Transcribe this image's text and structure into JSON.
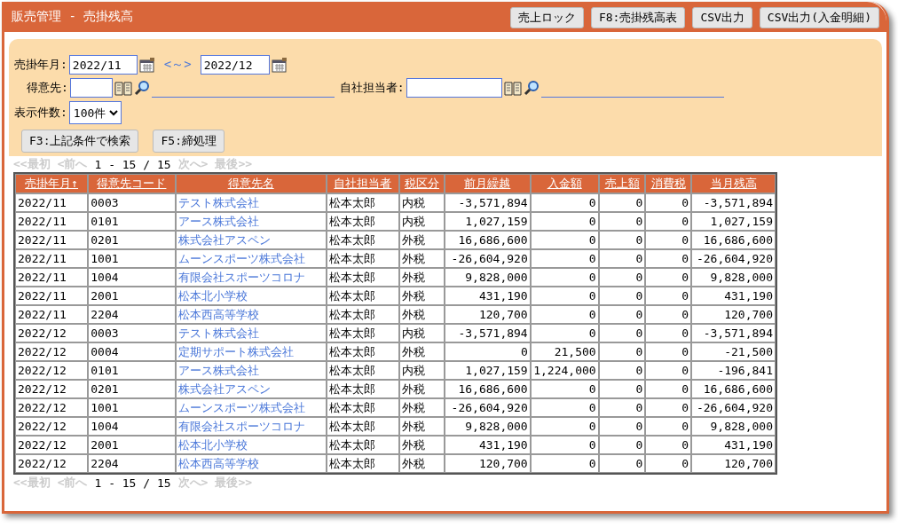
{
  "window": {
    "title": "販売管理 - 売掛残高"
  },
  "header_buttons": [
    "売上ロック",
    "F8:売掛残高表",
    "CSV出力",
    "CSV出力(入金明細)"
  ],
  "filters": {
    "period_label": "売掛年月:",
    "period_from": "2022/11",
    "range_separator": "<～>",
    "period_to": "2022/12",
    "customer_label": "得意先:",
    "staff_label": "自社担当者:",
    "count_label": "表示件数:",
    "count_value": "100件"
  },
  "action_buttons": [
    "F3:上記条件で検索",
    "F5:締処理"
  ],
  "pager_top": {
    "first": {
      "label": "<<最初",
      "disabled": true
    },
    "prev": {
      "label": "<前へ",
      "disabled": true
    },
    "range": "1 - 15 / 15",
    "next": {
      "label": "次へ>",
      "disabled": true
    },
    "last": {
      "label": "最後>>",
      "disabled": true
    }
  },
  "table": {
    "columns": [
      {
        "label": "売掛年月↑",
        "kind": "text"
      },
      {
        "label": "得意先コード",
        "kind": "text"
      },
      {
        "label": "得意先名",
        "kind": "link"
      },
      {
        "label": "自社担当者",
        "kind": "text"
      },
      {
        "label": "税区分",
        "kind": "text"
      },
      {
        "label": "前月繰越",
        "kind": "number"
      },
      {
        "label": "入金額",
        "kind": "number"
      },
      {
        "label": "売上額",
        "kind": "number"
      },
      {
        "label": "消費税",
        "kind": "number"
      },
      {
        "label": "当月残高",
        "kind": "number"
      }
    ],
    "rows": [
      [
        "2022/11",
        "0003",
        "テスト株式会社",
        "松本太郎",
        "内税",
        "-3,571,894",
        "0",
        "0",
        "0",
        "-3,571,894"
      ],
      [
        "2022/11",
        "0101",
        "アース株式会社",
        "松本太郎",
        "内税",
        "1,027,159",
        "0",
        "0",
        "0",
        "1,027,159"
      ],
      [
        "2022/11",
        "0201",
        "株式会社アスペン",
        "松本太郎",
        "外税",
        "16,686,600",
        "0",
        "0",
        "0",
        "16,686,600"
      ],
      [
        "2022/11",
        "1001",
        "ムーンスポーツ株式会社",
        "松本太郎",
        "外税",
        "-26,604,920",
        "0",
        "0",
        "0",
        "-26,604,920"
      ],
      [
        "2022/11",
        "1004",
        "有限会社スポーツコロナ",
        "松本太郎",
        "外税",
        "9,828,000",
        "0",
        "0",
        "0",
        "9,828,000"
      ],
      [
        "2022/11",
        "2001",
        "松本北小学校",
        "松本太郎",
        "外税",
        "431,190",
        "0",
        "0",
        "0",
        "431,190"
      ],
      [
        "2022/11",
        "2204",
        "松本西高等学校",
        "松本太郎",
        "外税",
        "120,700",
        "0",
        "0",
        "0",
        "120,700"
      ],
      [
        "2022/12",
        "0003",
        "テスト株式会社",
        "松本太郎",
        "内税",
        "-3,571,894",
        "0",
        "0",
        "0",
        "-3,571,894"
      ],
      [
        "2022/12",
        "0004",
        "定期サポート株式会社",
        "松本太郎",
        "外税",
        "0",
        "21,500",
        "0",
        "0",
        "-21,500"
      ],
      [
        "2022/12",
        "0101",
        "アース株式会社",
        "松本太郎",
        "内税",
        "1,027,159",
        "1,224,000",
        "0",
        "0",
        "-196,841"
      ],
      [
        "2022/12",
        "0201",
        "株式会社アスペン",
        "松本太郎",
        "外税",
        "16,686,600",
        "0",
        "0",
        "0",
        "16,686,600"
      ],
      [
        "2022/12",
        "1001",
        "ムーンスポーツ株式会社",
        "松本太郎",
        "外税",
        "-26,604,920",
        "0",
        "0",
        "0",
        "-26,604,920"
      ],
      [
        "2022/12",
        "1004",
        "有限会社スポーツコロナ",
        "松本太郎",
        "外税",
        "9,828,000",
        "0",
        "0",
        "0",
        "9,828,000"
      ],
      [
        "2022/12",
        "2001",
        "松本北小学校",
        "松本太郎",
        "外税",
        "431,190",
        "0",
        "0",
        "0",
        "431,190"
      ],
      [
        "2022/12",
        "2204",
        "松本西高等学校",
        "松本太郎",
        "外税",
        "120,700",
        "0",
        "0",
        "0",
        "120,700"
      ]
    ]
  },
  "pager_bottom": {
    "first": {
      "label": "<<最初",
      "disabled": true
    },
    "prev": {
      "label": "<前へ",
      "disabled": true
    },
    "range": "1 - 15 / 15",
    "next": {
      "label": "次へ>",
      "disabled": true
    },
    "last": {
      "label": "最後>>",
      "disabled": true
    }
  }
}
